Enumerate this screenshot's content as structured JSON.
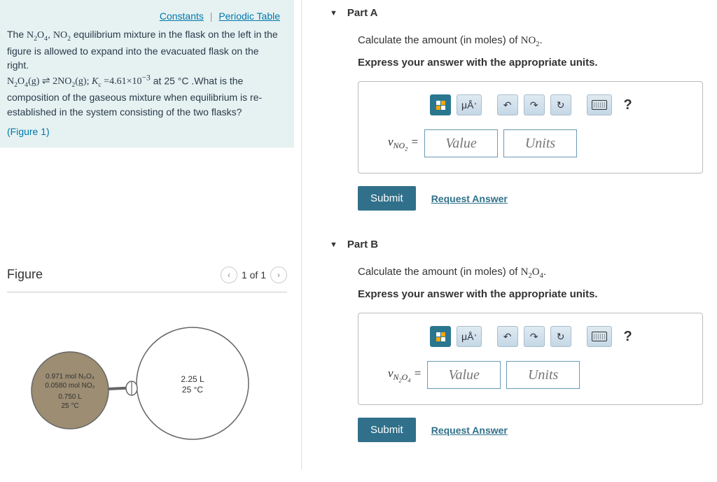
{
  "links": {
    "constants": "Constants",
    "periodic": "Periodic Table"
  },
  "problem": {
    "text_html": "The <span class='chem'>N<sub>2</sub>O<sub>4</sub></span>, <span class='chem'>NO<sub>2</sub></span> equilibrium mixture in the flask on the left in the figure is allowed to expand into the evacuated flask on the right.<br><span class='chem'>N<sub>2</sub>O<sub>4</sub>(g) ⇌ 2NO<sub>2</sub>(g); <i>K</i><sub>c</sub> =4.61×10<sup>−3</sup></span> at 25 °C .What is the composition of the gaseous mixture when equilibrium is re-established in the system consisting of the two flasks?",
    "figure_link": "(Figure 1)"
  },
  "figure": {
    "title": "Figure",
    "page": "1 of 1",
    "flask_left": {
      "line1": "0.971 mol N₂O₄",
      "line2": "0.0580 mol NO₂",
      "line3": "0.750 L",
      "line4": "25 °C"
    },
    "flask_right": {
      "line1": "2.25 L",
      "line2": "25 °C"
    }
  },
  "partA": {
    "title": "Part A",
    "instruction_html": "Calculate the amount (in moles) of <span class='chem'>NO<sub>2</sub></span>.",
    "express": "Express your answer with the appropriate units.",
    "var_html": "<i>ν</i><sub>NO<sub>2</sub></sub> =",
    "value_ph": "Value",
    "units_ph": "Units",
    "submit": "Submit",
    "request": "Request Answer"
  },
  "partB": {
    "title": "Part B",
    "instruction_html": "Calculate the amount (in moles) of <span class='chem'>N<sub>2</sub>O<sub>4</sub></span>.",
    "express": "Express your answer with the appropriate units.",
    "var_html": "<i>ν</i><sub>N<sub>2</sub>O<sub>4</sub></sub> =",
    "value_ph": "Value",
    "units_ph": "Units",
    "submit": "Submit",
    "request": "Request Answer"
  },
  "toolbar": {
    "units_btn": "μÅ"
  }
}
